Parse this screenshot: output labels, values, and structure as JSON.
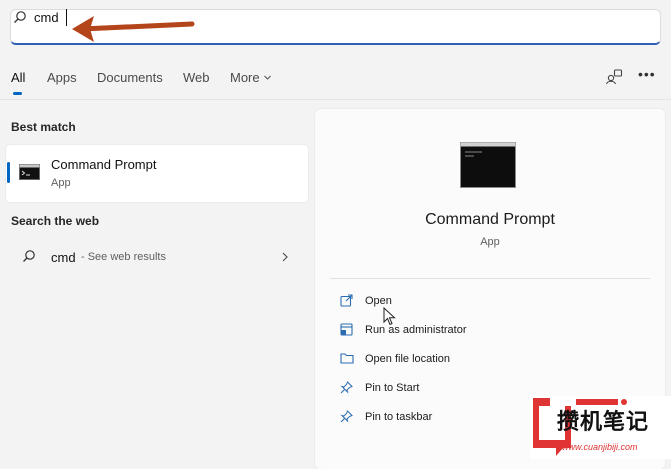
{
  "search": {
    "query": "cmd"
  },
  "tabs": [
    {
      "label": "All",
      "selected": true
    },
    {
      "label": "Apps"
    },
    {
      "label": "Documents"
    },
    {
      "label": "Web"
    },
    {
      "label": "More"
    }
  ],
  "best_match": {
    "section_title": "Best match",
    "name": "Command Prompt",
    "type": "App"
  },
  "web": {
    "section_title": "Search the web",
    "query": "cmd",
    "hint": "- See web results"
  },
  "details": {
    "title": "Command Prompt",
    "type": "App",
    "actions": [
      {
        "label": "Open",
        "icon": "open-external-icon"
      },
      {
        "label": "Run as administrator",
        "icon": "admin-shield-icon"
      },
      {
        "label": "Open file location",
        "icon": "folder-icon"
      },
      {
        "label": "Pin to Start",
        "icon": "pin-icon"
      },
      {
        "label": "Pin to taskbar",
        "icon": "pin-icon"
      }
    ]
  },
  "watermark": {
    "text": "攒机笔记",
    "url": "www.cuanjibiji.com"
  },
  "colors": {
    "accent": "#0067c0",
    "arrow": "#b4451a",
    "watermark_red": "#e03333"
  }
}
